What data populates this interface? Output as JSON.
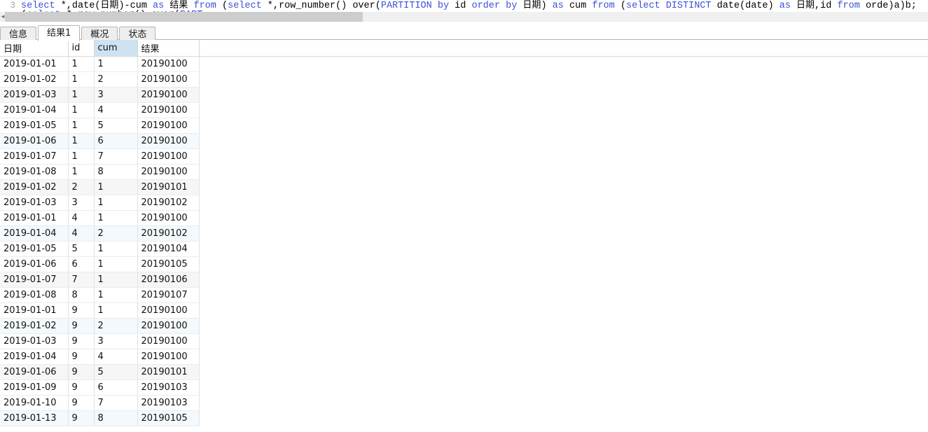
{
  "editor": {
    "line_number": "3",
    "sql_line1_segments": [
      {
        "t": "select",
        "c": "kw"
      },
      {
        "t": " *,date(",
        "c": "plain"
      },
      {
        "t": "日期",
        "c": "plain cjk"
      },
      {
        "t": ")-cum ",
        "c": "plain"
      },
      {
        "t": "as",
        "c": "kw"
      },
      {
        "t": " ",
        "c": "plain"
      },
      {
        "t": "结果",
        "c": "plain cjk"
      },
      {
        "t": " ",
        "c": "plain"
      },
      {
        "t": "from",
        "c": "kw"
      },
      {
        "t": " (",
        "c": "plain"
      },
      {
        "t": "select",
        "c": "kw"
      },
      {
        "t": " *,row_number() over(",
        "c": "plain"
      },
      {
        "t": "PARTITION",
        "c": "kw"
      },
      {
        "t": " ",
        "c": "plain"
      },
      {
        "t": "by",
        "c": "kw"
      },
      {
        "t": " id ",
        "c": "plain"
      },
      {
        "t": "order",
        "c": "kw"
      },
      {
        "t": " ",
        "c": "plain"
      },
      {
        "t": "by",
        "c": "kw"
      },
      {
        "t": " ",
        "c": "plain"
      },
      {
        "t": "日期",
        "c": "plain cjk"
      },
      {
        "t": ") ",
        "c": "plain"
      },
      {
        "t": "as",
        "c": "kw"
      },
      {
        "t": " cum ",
        "c": "plain"
      },
      {
        "t": "from",
        "c": "kw"
      },
      {
        "t": " (",
        "c": "plain"
      },
      {
        "t": "select",
        "c": "kw"
      },
      {
        "t": " ",
        "c": "plain"
      },
      {
        "t": "DISTINCT",
        "c": "kw"
      },
      {
        "t": " date(date) ",
        "c": "plain"
      },
      {
        "t": "as",
        "c": "kw"
      },
      {
        "t": " ",
        "c": "plain"
      },
      {
        "t": "日期",
        "c": "plain cjk"
      },
      {
        "t": ",id ",
        "c": "plain"
      },
      {
        "t": "from",
        "c": "kw"
      },
      {
        "t": " orde)a)b;",
        "c": "plain"
      }
    ],
    "sql_line2_segments": [
      {
        "t": "(",
        "c": "plain"
      },
      {
        "t": "select",
        "c": "kw"
      },
      {
        "t": " *,row_number() over(",
        "c": "plain"
      },
      {
        "t": "PART",
        "c": "kw"
      }
    ],
    "scrollbar": {
      "left_arrow": "◄"
    }
  },
  "tabs": [
    {
      "label": "信息",
      "active": false
    },
    {
      "label": "结果1",
      "active": true
    },
    {
      "label": "概况",
      "active": false
    },
    {
      "label": "状态",
      "active": false
    }
  ],
  "grid": {
    "columns": [
      {
        "key": "date",
        "label": "日期",
        "selected": false
      },
      {
        "key": "id",
        "label": "id",
        "selected": false
      },
      {
        "key": "cum",
        "label": "cum",
        "selected": true
      },
      {
        "key": "result",
        "label": "结果",
        "selected": false
      }
    ],
    "rows": [
      {
        "cells": [
          "2019-01-01",
          "1",
          "1",
          "20190100"
        ],
        "tint": "none"
      },
      {
        "cells": [
          "2019-01-02",
          "1",
          "2",
          "20190100"
        ],
        "tint": "none"
      },
      {
        "cells": [
          "2019-01-03",
          "1",
          "3",
          "20190100"
        ],
        "tint": "gray"
      },
      {
        "cells": [
          "2019-01-04",
          "1",
          "4",
          "20190100"
        ],
        "tint": "none"
      },
      {
        "cells": [
          "2019-01-05",
          "1",
          "5",
          "20190100"
        ],
        "tint": "none"
      },
      {
        "cells": [
          "2019-01-06",
          "1",
          "6",
          "20190100"
        ],
        "tint": "blue"
      },
      {
        "cells": [
          "2019-01-07",
          "1",
          "7",
          "20190100"
        ],
        "tint": "none"
      },
      {
        "cells": [
          "2019-01-08",
          "1",
          "8",
          "20190100"
        ],
        "tint": "none"
      },
      {
        "cells": [
          "2019-01-02",
          "2",
          "1",
          "20190101"
        ],
        "tint": "gray"
      },
      {
        "cells": [
          "2019-01-03",
          "3",
          "1",
          "20190102"
        ],
        "tint": "none"
      },
      {
        "cells": [
          "2019-01-01",
          "4",
          "1",
          "20190100"
        ],
        "tint": "none"
      },
      {
        "cells": [
          "2019-01-04",
          "4",
          "2",
          "20190102"
        ],
        "tint": "blue"
      },
      {
        "cells": [
          "2019-01-05",
          "5",
          "1",
          "20190104"
        ],
        "tint": "none"
      },
      {
        "cells": [
          "2019-01-06",
          "6",
          "1",
          "20190105"
        ],
        "tint": "none"
      },
      {
        "cells": [
          "2019-01-07",
          "7",
          "1",
          "20190106"
        ],
        "tint": "gray"
      },
      {
        "cells": [
          "2019-01-08",
          "8",
          "1",
          "20190107"
        ],
        "tint": "none"
      },
      {
        "cells": [
          "2019-01-01",
          "9",
          "1",
          "20190100"
        ],
        "tint": "none"
      },
      {
        "cells": [
          "2019-01-02",
          "9",
          "2",
          "20190100"
        ],
        "tint": "blue"
      },
      {
        "cells": [
          "2019-01-03",
          "9",
          "3",
          "20190100"
        ],
        "tint": "none"
      },
      {
        "cells": [
          "2019-01-04",
          "9",
          "4",
          "20190100"
        ],
        "tint": "none"
      },
      {
        "cells": [
          "2019-01-06",
          "9",
          "5",
          "20190101"
        ],
        "tint": "gray"
      },
      {
        "cells": [
          "2019-01-09",
          "9",
          "6",
          "20190103"
        ],
        "tint": "none"
      },
      {
        "cells": [
          "2019-01-10",
          "9",
          "7",
          "20190103"
        ],
        "tint": "none"
      },
      {
        "cells": [
          "2019-01-13",
          "9",
          "8",
          "20190105"
        ],
        "tint": "blue"
      }
    ]
  },
  "colors": {
    "keyword": "#3a50d8",
    "selected_header": "#cde3f2",
    "row_tint_blue": "#f3f9fd",
    "row_tint_gray": "#f6f6f6",
    "scrollbar_thumb": "#cdcdcd"
  }
}
